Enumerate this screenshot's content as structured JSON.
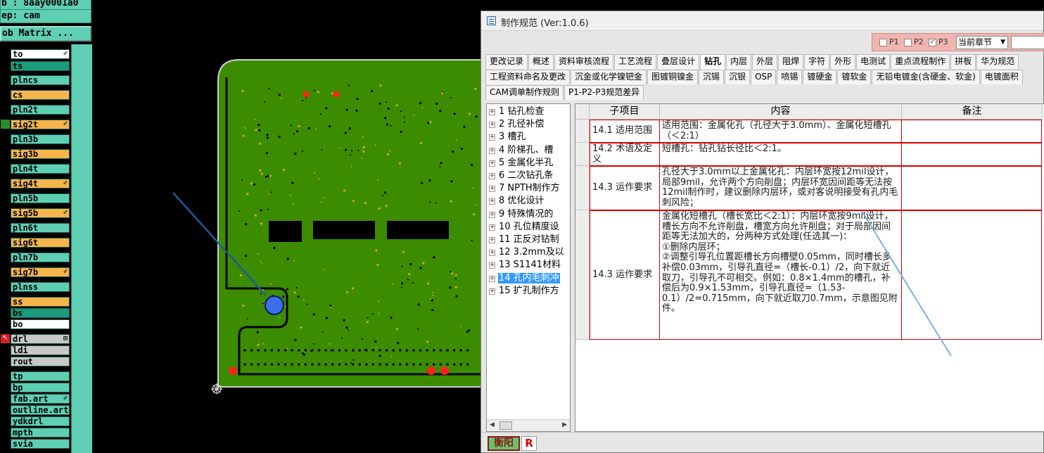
{
  "left_panel": {
    "job_label": "b : 8aay0001a0",
    "step_label": "ep: cam",
    "matrix_button": "ob Matrix ...",
    "layers": [
      {
        "name": "to",
        "color": "white",
        "marker": "✐"
      },
      {
        "name": "ts",
        "color": "dteal",
        "marker": ""
      },
      {
        "name": "plncs",
        "color": "teal",
        "marker": ""
      },
      {
        "name": "cs",
        "color": "orange",
        "marker": ""
      },
      {
        "name": "pln2t",
        "color": "teal",
        "marker": ""
      },
      {
        "name": "sig2t",
        "color": "orange",
        "marker": "✐"
      },
      {
        "name": "pln3b",
        "color": "teal",
        "marker": ""
      },
      {
        "name": "sig3b",
        "color": "orange",
        "marker": ""
      },
      {
        "name": "pln4t",
        "color": "teal",
        "marker": ""
      },
      {
        "name": "sig4t",
        "color": "orange",
        "marker": "✐"
      },
      {
        "name": "pln5b",
        "color": "teal",
        "marker": ""
      },
      {
        "name": "sig5b",
        "color": "orange",
        "marker": "✐"
      },
      {
        "name": "pln6t",
        "color": "teal",
        "marker": ""
      },
      {
        "name": "sig6t",
        "color": "orange",
        "marker": ""
      },
      {
        "name": "pln7b",
        "color": "teal",
        "marker": ""
      },
      {
        "name": "sig7b",
        "color": "orange",
        "marker": "✐"
      },
      {
        "name": "plnss",
        "color": "teal",
        "marker": ""
      },
      {
        "name": "ss",
        "color": "orange",
        "marker": ""
      },
      {
        "name": "bs",
        "color": "dteal",
        "marker": ""
      },
      {
        "name": "bo",
        "color": "white",
        "marker": ""
      },
      {
        "name": "drl",
        "color": "grey",
        "marker": "⊞"
      },
      {
        "name": "ldi",
        "color": "grey",
        "marker": ""
      },
      {
        "name": "rout",
        "color": "grey",
        "marker": ""
      },
      {
        "name": "tp",
        "color": "teal",
        "marker": ""
      },
      {
        "name": "bp",
        "color": "teal",
        "marker": ""
      },
      {
        "name": "fab.art",
        "color": "teal",
        "marker": "✐"
      },
      {
        "name": "outline.art",
        "color": "teal",
        "marker": ""
      },
      {
        "name": "ydkdrl",
        "color": "teal",
        "marker": ""
      },
      {
        "name": "mpth",
        "color": "teal",
        "marker": ""
      },
      {
        "name": "svia",
        "color": "teal",
        "marker": ""
      }
    ]
  },
  "window": {
    "title": "制作规范 (Ver:1.0.6)",
    "toolbar": {
      "p1_label": "P1",
      "p2_label": "P2",
      "p3_label": "P3",
      "p3_checked": "✓",
      "chapter_select": "当前章节",
      "chapter_arrow": "▼"
    },
    "tabs_row1": [
      "更改记录",
      "概述",
      "资料审核流程",
      "工艺流程",
      "叠层设计",
      "钻孔",
      "内层",
      "外层",
      "阻焊",
      "字符",
      "外形",
      "电测试",
      "重点流程制作",
      "拼板",
      "华为规范"
    ],
    "tabs_row2": [
      "工程资料命名及更改",
      "沉金或化学镍钯金",
      "图镀铜镍金",
      "沉锡",
      "沉银",
      "OSP",
      "喷锡",
      "镀硬金",
      "镀软金",
      "无铅电镀金(含硬金、软金)",
      "电镀面积"
    ],
    "tabs_row3": [
      "CAM调单制作规则",
      "P1-P2-P3规范差异"
    ],
    "active_tab": "钻孔",
    "tree": [
      "1 钻孔检查",
      "2 孔径补偿",
      "3 槽孔",
      "4 阶梯孔、槽",
      "5 金属化半孔",
      "6 二次钻孔条",
      "7 NPTH制作方",
      "8 优化设计",
      "9 特殊情况的",
      "10 孔位精度设",
      "11 正反对钻制",
      "12 3.2mm及以",
      "13 S1141材料",
      "14 孔内毛刺冲",
      "15 扩孔制作方"
    ],
    "tree_selected_index": 13,
    "grid": {
      "headers": [
        "子项目",
        "内容",
        "备注"
      ],
      "rows": [
        {
          "sub": "14.1 适用范围",
          "content": "适用范围：金属化孔（孔径大于3.0mm）、金属化短槽孔（＜2:1）",
          "remark": ""
        },
        {
          "sub": "14.2 术语及定义",
          "content": "短槽孔：钻孔钻长径比＜2:1。",
          "remark": ""
        },
        {
          "sub": "14.3 运作要求",
          "content": "孔径大于3.0mm以上金属化孔：内层环宽按12mil设计，局部9mil，允许两个方向削盘；内层环宽因间距等无法按12mil制作时，建议删除内层环，或对客说明接受有孔内毛刺风险；",
          "remark": ""
        },
        {
          "sub": "14.3 运作要求",
          "content": "金属化短槽孔（槽长宽比＜2:1）：内层环宽按9mil设计，槽长方向不允许削盘，槽宽方向允许削盘；对于局部因间距等无法加大的，分两种方式处理(任选其一)：\n①删除内层环；\n②调整引导孔位置距槽长方向槽壁0.05mm，同时槽长多补偿0.03mm，引导孔直径=（槽长-0.1）/2，向下就近取刀，引导孔不可相交。例如：0.8×1.4mm的槽孔，补偿后为0.9×1.53mm，引导孔直径=（1.53-0.1）/2=0.715mm，向下就近取刀0.7mm，示意图见附件。",
          "remark": ""
        }
      ]
    },
    "bottom": {
      "brand": "衡阳",
      "r_label": "R"
    }
  },
  "colors": {
    "pcb_green": "#3c8c00",
    "pad_red": "#ff2020",
    "via_blue": "#3c6ee8",
    "panel_teal": "#5fcfb4",
    "layer_orange": "#f5b54a",
    "grid_border_red": "#d40000"
  }
}
